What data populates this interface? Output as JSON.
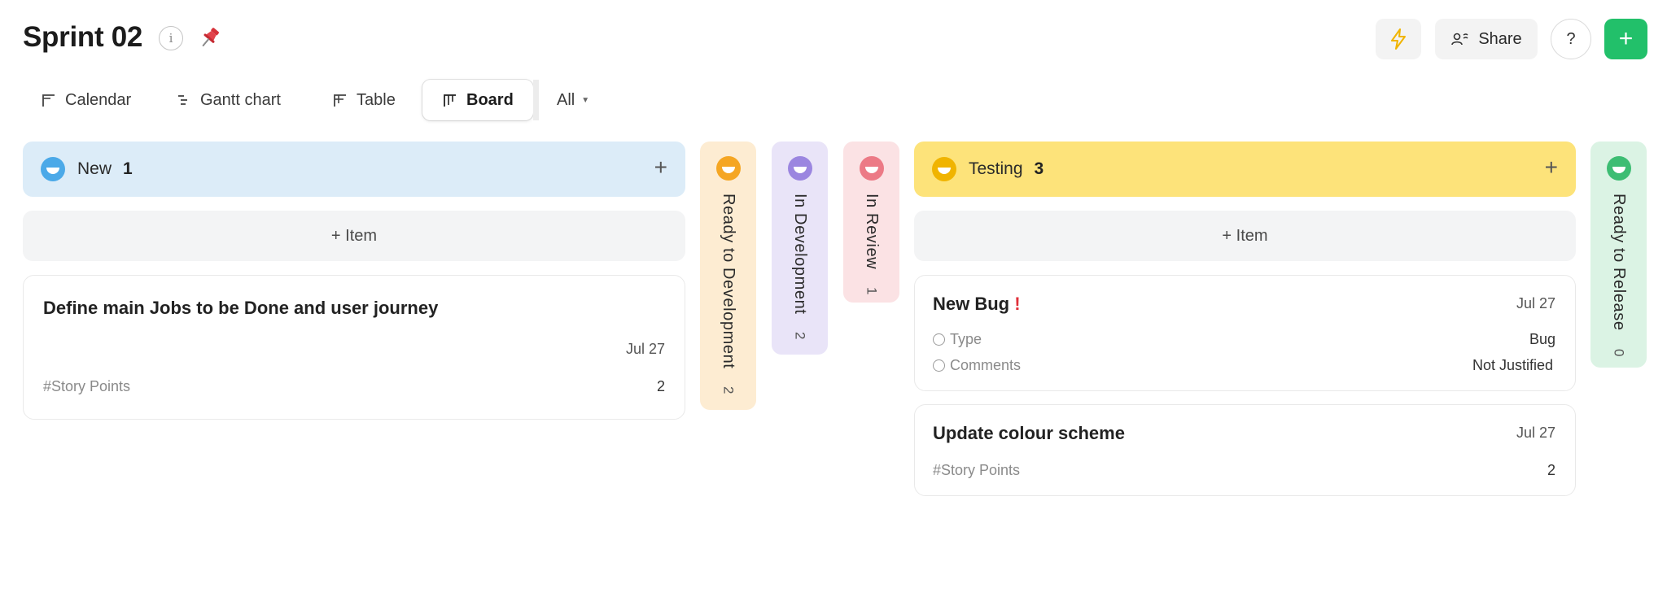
{
  "header": {
    "title": "Sprint 02",
    "info_icon": "i",
    "share_label": "Share",
    "help_label": "?",
    "add_label": "+"
  },
  "tabs": [
    {
      "label": "Calendar",
      "icon": "calendar-icon"
    },
    {
      "label": "Gantt chart",
      "icon": "gantt-icon"
    },
    {
      "label": "Table",
      "icon": "table-icon"
    },
    {
      "label": "Board",
      "icon": "board-icon",
      "active": true
    },
    {
      "label": "All",
      "icon": "chevron-down-icon"
    }
  ],
  "columns": [
    {
      "name": "New",
      "count": "1",
      "color": "#dcecf8",
      "dot": "#4ba9e8",
      "collapsed": false
    },
    {
      "name": "Ready to Development",
      "count": "2",
      "color": "#fdecd2",
      "dot": "#f5a623",
      "collapsed": true
    },
    {
      "name": "In Development",
      "count": "2",
      "color": "#e9e4f8",
      "dot": "#9b86e0",
      "collapsed": true
    },
    {
      "name": "In Review",
      "count": "1",
      "color": "#fbe2e4",
      "dot": "#ec7a86",
      "collapsed": true
    },
    {
      "name": "Testing",
      "count": "3",
      "color": "#fde37a",
      "dot": "#f0b400",
      "collapsed": false
    },
    {
      "name": "Ready to Release",
      "count": "0",
      "color": "#dbf3e4",
      "dot": "#3dbd73",
      "collapsed": true
    }
  ],
  "add_item_label": "+ Item",
  "cards": {
    "new_card": {
      "title": "Define main Jobs to be Done and user journey",
      "date": "Jul 27",
      "prop_label": "#Story Points",
      "prop_value": "2"
    },
    "bug_card": {
      "title": "New Bug",
      "priority_mark": "!",
      "date": "Jul 27",
      "props": [
        {
          "label": "Type",
          "value": "Bug"
        },
        {
          "label": "Comments",
          "value": "Not Justified"
        }
      ]
    },
    "colour_card": {
      "title": "Update colour scheme",
      "date": "Jul 27",
      "prop_label": "#Story Points",
      "prop_value": "2"
    }
  }
}
